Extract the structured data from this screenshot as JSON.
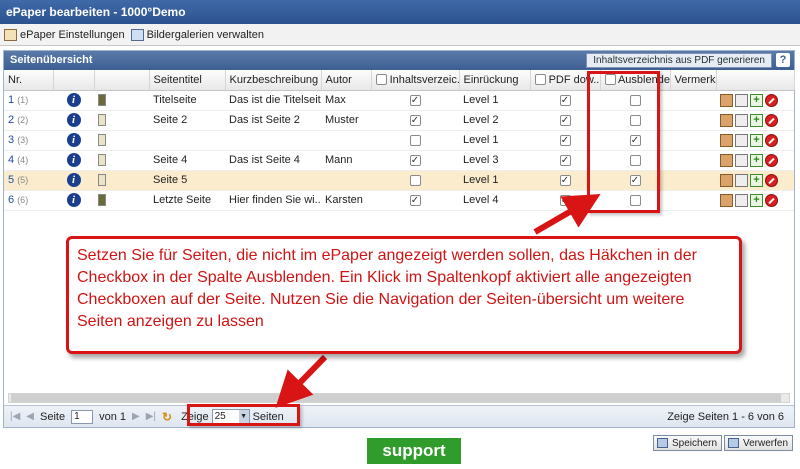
{
  "window": {
    "title": "ePaper bearbeiten - 1000°Demo"
  },
  "toolbar": {
    "items": [
      {
        "label": "ePaper Einstellungen",
        "icon": "settings-icon"
      },
      {
        "label": "Bildergalerien verwalten",
        "icon": "gallery-icon"
      }
    ]
  },
  "panel": {
    "title": "Seitenübersicht",
    "pdf_button": "Inhaltsverzeichnis aus PDF generieren",
    "help_icon": "?"
  },
  "table": {
    "headers": [
      "Nr.",
      "",
      "",
      "Seitentitel",
      "Kurzbeschreibung",
      "Autor",
      "Inhaltsverzeic...",
      "Einrückung",
      "PDF dow...",
      "Ausblenden",
      "Vermerk",
      ""
    ],
    "rows": [
      {
        "nr": "1",
        "sub": "(1)",
        "thumb": "dark",
        "title": "Titelseite",
        "desc": "Das ist die Titelseite",
        "author": "Max",
        "toc": true,
        "indent": "Level 1",
        "pdf": true,
        "hide": false
      },
      {
        "nr": "2",
        "sub": "(2)",
        "thumb": "light",
        "title": "Seite 2",
        "desc": "Das ist Seite 2",
        "author": "Muster",
        "toc": true,
        "indent": "Level 2",
        "pdf": true,
        "hide": false
      },
      {
        "nr": "3",
        "sub": "(3)",
        "thumb": "light",
        "title": "",
        "desc": "",
        "author": "",
        "toc": false,
        "indent": "Level 1",
        "pdf": true,
        "hide": true
      },
      {
        "nr": "4",
        "sub": "(4)",
        "thumb": "light",
        "title": "Seite 4",
        "desc": "Das ist Seite 4",
        "author": "Mann",
        "toc": true,
        "indent": "Level 3",
        "pdf": true,
        "hide": false
      },
      {
        "nr": "5",
        "sub": "(5)",
        "thumb": "light",
        "title": "Seite 5",
        "desc": "",
        "author": "",
        "toc": false,
        "indent": "Level 1",
        "pdf": true,
        "hide": true,
        "highlight": true
      },
      {
        "nr": "6",
        "sub": "(6)",
        "thumb": "dark",
        "title": "Letzte Seite",
        "desc": "Hier finden Sie wi...",
        "author": "Karsten",
        "toc": true,
        "indent": "Level 4",
        "pdf": true,
        "hide": false
      }
    ]
  },
  "callout": {
    "text": "Setzen Sie für Seiten, die nicht im ePaper angezeigt werden sollen, das Häkchen in der Checkbox in der Spalte Ausblenden. Ein Klick im Spaltenkopf aktiviert alle angezeigten Checkboxen auf der Seite. Nutzen Sie die Navigation der  Seiten-übersicht um weitere Seiten anzeigen zu lassen"
  },
  "pager": {
    "page_label": "Seite",
    "page_value": "1",
    "of_label": "von 1",
    "show_label": "Zeige",
    "page_size": "25",
    "pages_label": "Seiten",
    "summary": "Zeige Seiten 1 - 6 von 6"
  },
  "footer": {
    "support": "support",
    "save": "Speichern",
    "discard": "Verwerfen"
  },
  "colors": {
    "callout_red": "#d91414",
    "header_blue": "#3d5f93",
    "support_green": "#2f9c2c",
    "row_highlight": "#fbeccd"
  }
}
